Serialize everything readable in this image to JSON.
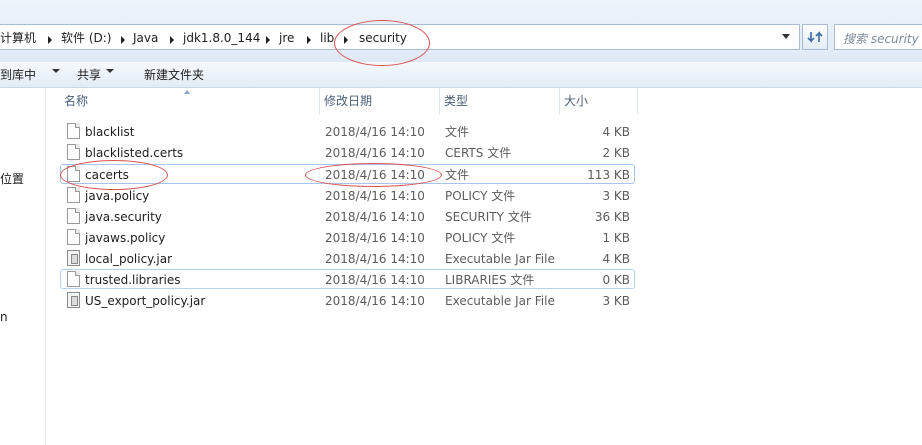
{
  "breadcrumb": {
    "items": [
      "计算机",
      "软件 (D:)",
      "Java",
      "jdk1.8.0_144",
      "jre",
      "lib",
      "security"
    ]
  },
  "search": {
    "placeholder": "搜索 security"
  },
  "toolbar": {
    "include_in_library": "到库中",
    "share": "共享",
    "new_folder": "新建文件夹"
  },
  "nav": {
    "location_label": "位置",
    "stub_label": "n"
  },
  "columns": {
    "name": "名称",
    "date": "修改日期",
    "type": "类型",
    "size": "大小"
  },
  "files": [
    {
      "name": "blacklist",
      "date": "2018/4/16 14:10",
      "type": "文件",
      "size": "4 KB",
      "icon": "file-icon"
    },
    {
      "name": "blacklisted.certs",
      "date": "2018/4/16 14:10",
      "type": "CERTS 文件",
      "size": "2 KB",
      "icon": "file-icon"
    },
    {
      "name": "cacerts",
      "date": "2018/4/16 14:10",
      "type": "文件",
      "size": "113 KB",
      "icon": "file-icon"
    },
    {
      "name": "java.policy",
      "date": "2018/4/16 14:10",
      "type": "POLICY 文件",
      "size": "3 KB",
      "icon": "file-icon"
    },
    {
      "name": "java.security",
      "date": "2018/4/16 14:10",
      "type": "SECURITY 文件",
      "size": "36 KB",
      "icon": "file-icon"
    },
    {
      "name": "javaws.policy",
      "date": "2018/4/16 14:10",
      "type": "POLICY 文件",
      "size": "1 KB",
      "icon": "file-icon"
    },
    {
      "name": "local_policy.jar",
      "date": "2018/4/16 14:10",
      "type": "Executable Jar File",
      "size": "4 KB",
      "icon": "jar-icon"
    },
    {
      "name": "trusted.libraries",
      "date": "2018/4/16 14:10",
      "type": "LIBRARIES 文件",
      "size": "0 KB",
      "icon": "file-icon"
    },
    {
      "name": "US_export_policy.jar",
      "date": "2018/4/16 14:10",
      "type": "Executable Jar File",
      "size": "3 KB",
      "icon": "jar-icon"
    }
  ],
  "colors": {
    "annotation": "#d9534f",
    "selection_border": "#a5c7ee"
  }
}
